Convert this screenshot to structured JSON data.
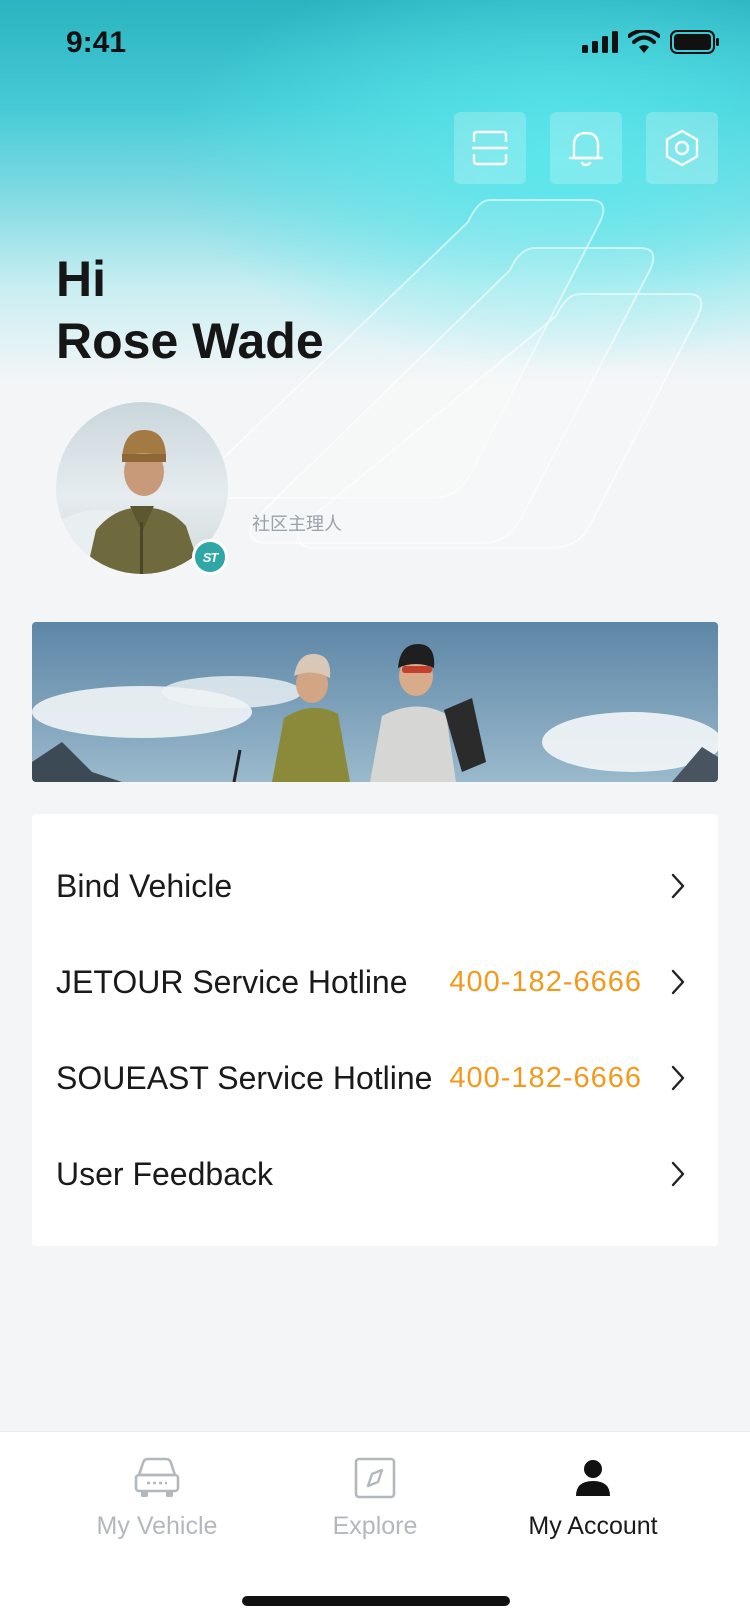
{
  "status_bar": {
    "time": "9:41"
  },
  "header": {
    "actions": [
      {
        "icon": "scan-icon"
      },
      {
        "icon": "bell-icon"
      },
      {
        "icon": "settings-icon"
      }
    ]
  },
  "profile": {
    "greeting": "Hi",
    "name": "Rose Wade",
    "badge_text": "ST",
    "role": "社区主理人"
  },
  "menu": {
    "items": [
      {
        "label": "Bind Vehicle",
        "value": ""
      },
      {
        "label": "JETOUR Service Hotline",
        "value": "400-182-6666"
      },
      {
        "label": "SOUEAST Service Hotline",
        "value": "400-182-6666"
      },
      {
        "label": "User Feedback",
        "value": ""
      }
    ]
  },
  "tabbar": {
    "tabs": [
      {
        "label": "My Vehicle",
        "icon": "car-icon",
        "active": false
      },
      {
        "label": "Explore",
        "icon": "compass-icon",
        "active": false
      },
      {
        "label": "My Account",
        "icon": "person-icon",
        "active": true
      }
    ]
  },
  "colors": {
    "accent_orange": "#f39a1c",
    "hero_cyan": "#5ae8ec",
    "badge_teal": "#2fa7a6",
    "inactive_tab": "#b3b8bf"
  }
}
